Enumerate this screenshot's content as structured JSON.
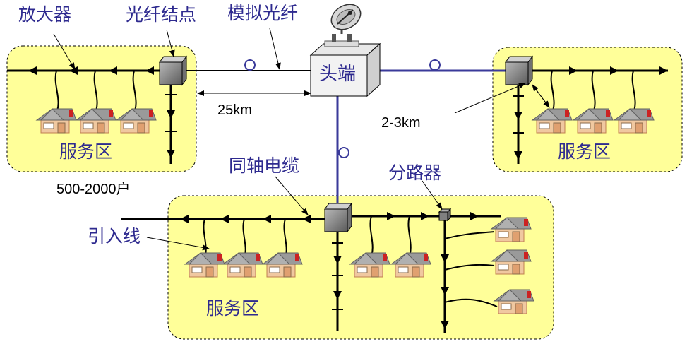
{
  "labels": {
    "amplifier": "放大器",
    "fiber_node": "光纤结点",
    "analog_fiber": "模拟光纤",
    "headend": "头端",
    "distance_25km": "25km",
    "distance_2_3km": "2-3km",
    "service_area_left": "服务区",
    "service_area_right": "服务区",
    "service_area_bottom": "服务区",
    "households": "500-2000户",
    "coax_cable": "同轴电缆",
    "splitter": "分路器",
    "drop_line": "引入线"
  },
  "colors": {
    "area_fill": "#ffff99",
    "fiber_line": "#3a3a9a",
    "coax_line": "#000000",
    "label_blue": "#2e2a8f",
    "house_wall": "#f0c8a0",
    "house_roof": "#8a8a8a",
    "chimney": "#cc2222"
  },
  "icons": [
    "satellite-dish-icon",
    "node-box-icon",
    "splitter-icon",
    "house-icon",
    "amplifier-arrow-icon",
    "fiber-coil-icon"
  ]
}
